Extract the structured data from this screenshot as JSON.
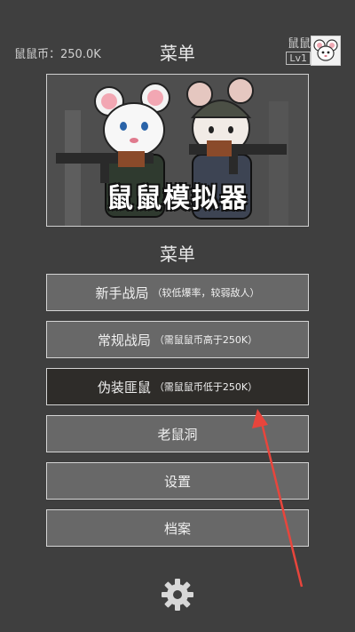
{
  "header": {
    "coins_label": "鼠鼠币：250.0K",
    "title": "菜单",
    "username": "鼠鼠",
    "level": "Lv1"
  },
  "banner": {
    "game_title": "鼠鼠模拟器"
  },
  "menu": {
    "heading": "菜单",
    "buttons": [
      {
        "label": "新手战局",
        "note": "（较低爆率，较弱敌人）"
      },
      {
        "label": "常规战局",
        "note": "（需鼠鼠币高于250K）"
      },
      {
        "label": "伪装匪鼠",
        "note": "（需鼠鼠币低于250K）"
      },
      {
        "label": "老鼠洞",
        "note": ""
      },
      {
        "label": "设置",
        "note": ""
      },
      {
        "label": "档案",
        "note": ""
      }
    ]
  },
  "icons": {
    "settings": "gear-icon",
    "avatar": "mouse-avatar-icon"
  },
  "colors": {
    "background": "#3f3f3f",
    "button": "#686868",
    "button_selected": "#2e2c29",
    "annotation_arrow": "#e8453c"
  }
}
